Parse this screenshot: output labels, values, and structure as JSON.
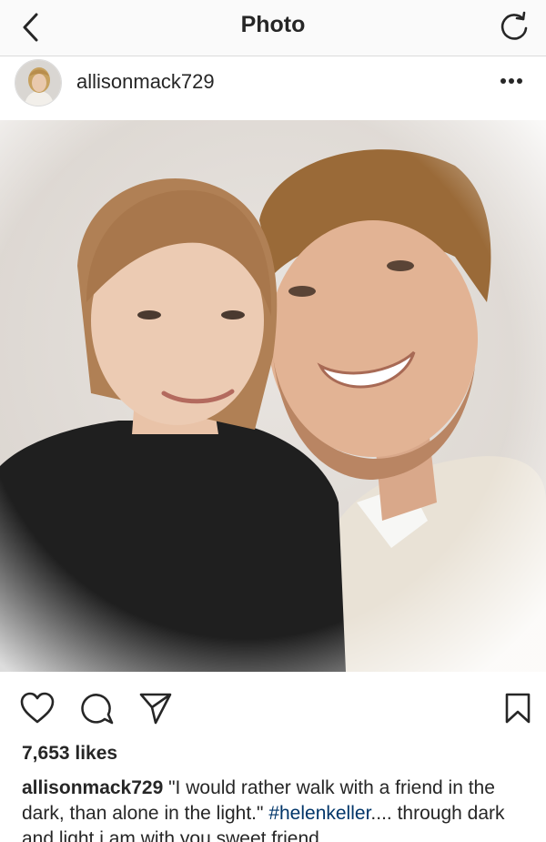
{
  "header": {
    "title": "Photo",
    "back_icon": "chevron-left-icon",
    "refresh_icon": "refresh-icon"
  },
  "post": {
    "username": "allisonmack729",
    "more_icon": "more-dots-icon",
    "avatar_icon": "avatar-photo"
  },
  "actions": {
    "like_icon": "heart-icon",
    "comment_icon": "comment-icon",
    "share_icon": "send-icon",
    "save_icon": "bookmark-icon"
  },
  "likes": "7,653 likes",
  "caption": {
    "username": "allisonmack729",
    "text_before_hashtag": " \"I would rather walk with a friend in the dark, than alone in the light.\" ",
    "hashtag": "#helenkeller",
    "text_after_hashtag": ".... through dark and light i am with you sweet friend...."
  },
  "colors": {
    "text": "#262626",
    "hashtag": "#003569",
    "border": "#dbdbdb",
    "nav_bg": "#fafafa"
  }
}
